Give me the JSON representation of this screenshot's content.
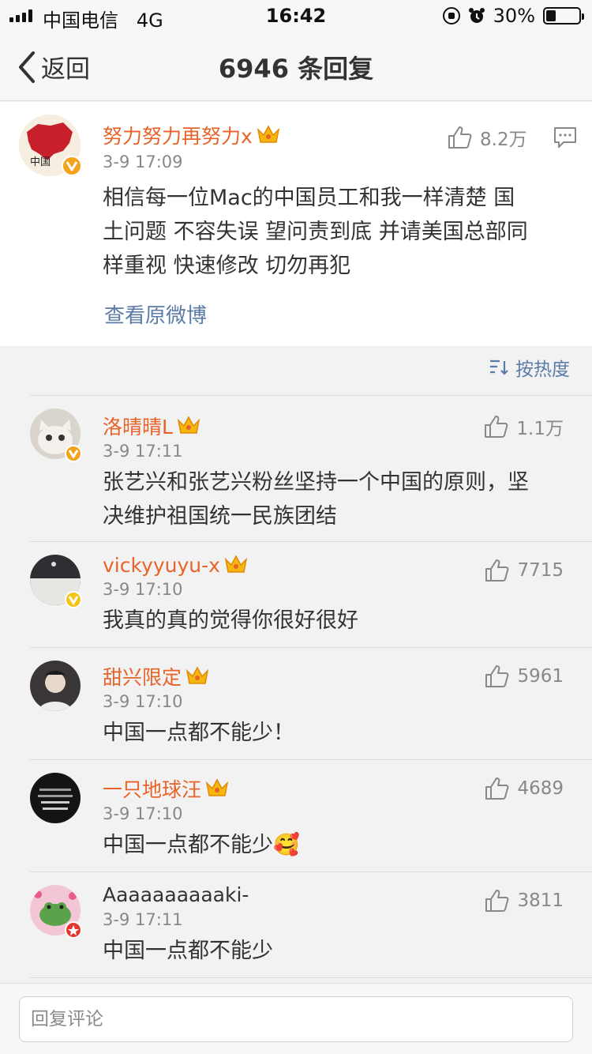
{
  "status_bar": {
    "carrier": "中国电信",
    "network": "4G",
    "time": "16:42",
    "battery": "30%",
    "battery_level": 0.3
  },
  "nav": {
    "back_label": "返回",
    "title": "6946 条回复"
  },
  "original_post": {
    "username": "努力努力再努力x",
    "time": "3-9 17:09",
    "likes": "8.2万",
    "text_lines": [
      "相信每一位Mac的中国员工和我一样清楚 国",
      "土问题 不容失误 望问责到底 并请美国总部同",
      "样重视 快速修改 切勿再犯"
    ],
    "view_original": "查看原微博",
    "avatar_text": "中国"
  },
  "sort": {
    "label": "按热度"
  },
  "comments": [
    {
      "username": "洛晴晴L",
      "time": "3-9 17:11",
      "likes": "1.1万",
      "text_lines": [
        "张艺兴和张艺兴粉丝坚持一个中国的原则，坚",
        "决维护祖国统一民族团结"
      ]
    },
    {
      "username": "vickyyuyu-x",
      "time": "3-9 17:10",
      "likes": "7715",
      "text_lines": [
        "我真的真的觉得你很好很好"
      ]
    },
    {
      "username": "甜兴限定",
      "time": "3-9 17:10",
      "likes": "5961",
      "text_lines": [
        "中国一点都不能少！"
      ]
    },
    {
      "username": "一只地球汪",
      "time": "3-9 17:10",
      "likes": "4689",
      "text_lines": [
        "中国一点都不能少🥰"
      ]
    },
    {
      "username": "Aaaaaaaaaaki-",
      "time": "3-9 17:11",
      "likes": "3811",
      "text_lines": [
        "中国一点都不能少"
      ]
    }
  ],
  "reply_bar": {
    "placeholder": "回复评论"
  },
  "colors": {
    "username_vip": "#e8632a",
    "link": "#5b7ca6",
    "meta": "#888888"
  }
}
